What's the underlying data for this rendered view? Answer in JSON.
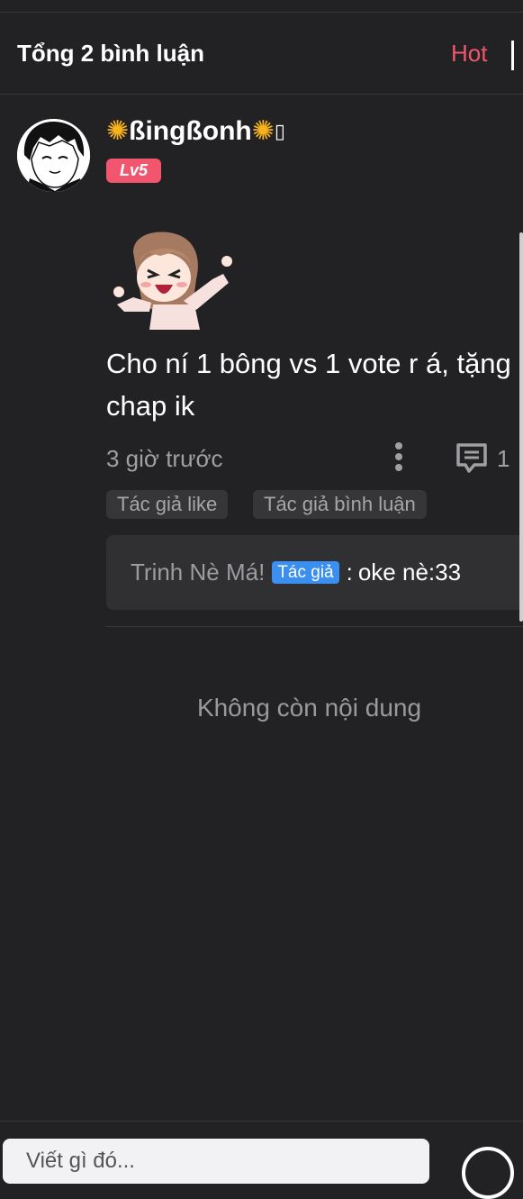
{
  "header": {
    "title": "Tổng 2 bình luận",
    "sort_label": "Hot"
  },
  "comment": {
    "username": "ßingßonh",
    "username_trailing_glyph": "▯",
    "level": "Lv5",
    "text": "Cho ní 1 bông vs 1 vote r á, tặng chap ik",
    "time": "3 giờ trước",
    "reply_count": "1",
    "tags": [
      "Tác giả like",
      "Tác giả bình luận"
    ],
    "reply": {
      "author": "Trinh Nè Má!",
      "badge": "Tác giả",
      "separator": ":",
      "text": "oke nè:33"
    }
  },
  "footer": {
    "end_text": "Không còn nội dung",
    "input_placeholder": "Viết gì đó..."
  },
  "colors": {
    "background": "#222224",
    "accent_pink": "#f2566e",
    "author_badge_blue": "#3a8ff0",
    "flower_yellow": "#f7b21c"
  },
  "icons": [
    "flower-icon",
    "more-vertical-icon",
    "comment-reply-icon",
    "send-icon"
  ]
}
